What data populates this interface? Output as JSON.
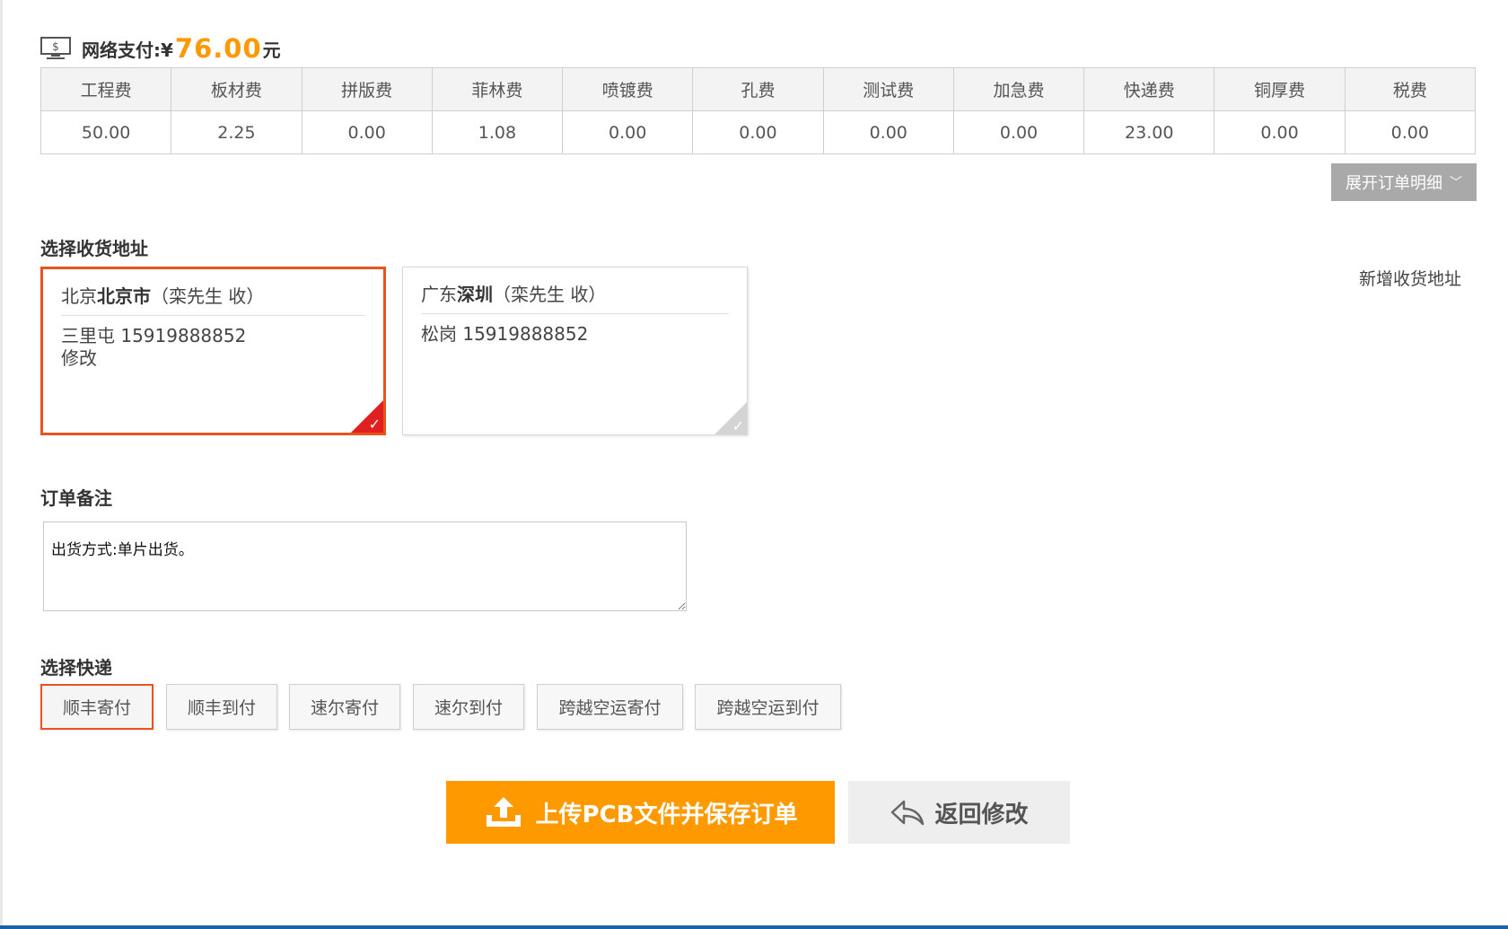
{
  "payment": {
    "label": "网络支付:¥",
    "amount": "76.00",
    "unit": "元"
  },
  "fees": {
    "headers": [
      "工程费",
      "板材费",
      "拼版费",
      "菲林费",
      "喷镀费",
      "孔费",
      "测试费",
      "加急费",
      "快递费",
      "铜厚费",
      "税费"
    ],
    "values": [
      "50.00",
      "2.25",
      "0.00",
      "1.08",
      "0.00",
      "0.00",
      "0.00",
      "0.00",
      "23.00",
      "0.00",
      "0.00"
    ]
  },
  "expand_button": "展开订单明细",
  "address_section": {
    "title": "选择收货地址",
    "new_address": "新增收货地址",
    "cards": [
      {
        "province": "北京",
        "city": "北京市",
        "receiver": "（栾先生 收）",
        "detail": "三里屯 15919888852",
        "edit": "修改",
        "selected": true
      },
      {
        "province": "广东",
        "city": "深圳",
        "receiver": "（栾先生 收）",
        "detail": "松岗 15919888852",
        "edit": "",
        "selected": false
      }
    ]
  },
  "remark": {
    "title": "订单备注",
    "value": "出货方式:单片出货。"
  },
  "shipping": {
    "title": "选择快递",
    "options": [
      "顺丰寄付",
      "顺丰到付",
      "速尔寄付",
      "速尔到付",
      "跨越空运寄付",
      "跨越空运到付"
    ],
    "selected": "顺丰寄付"
  },
  "actions": {
    "upload": "上传PCB文件并保存订单",
    "back": "返回修改"
  },
  "colors": {
    "accent_orange": "#ff9900",
    "selected_border": "#e8541e",
    "check_red": "#e02020"
  }
}
